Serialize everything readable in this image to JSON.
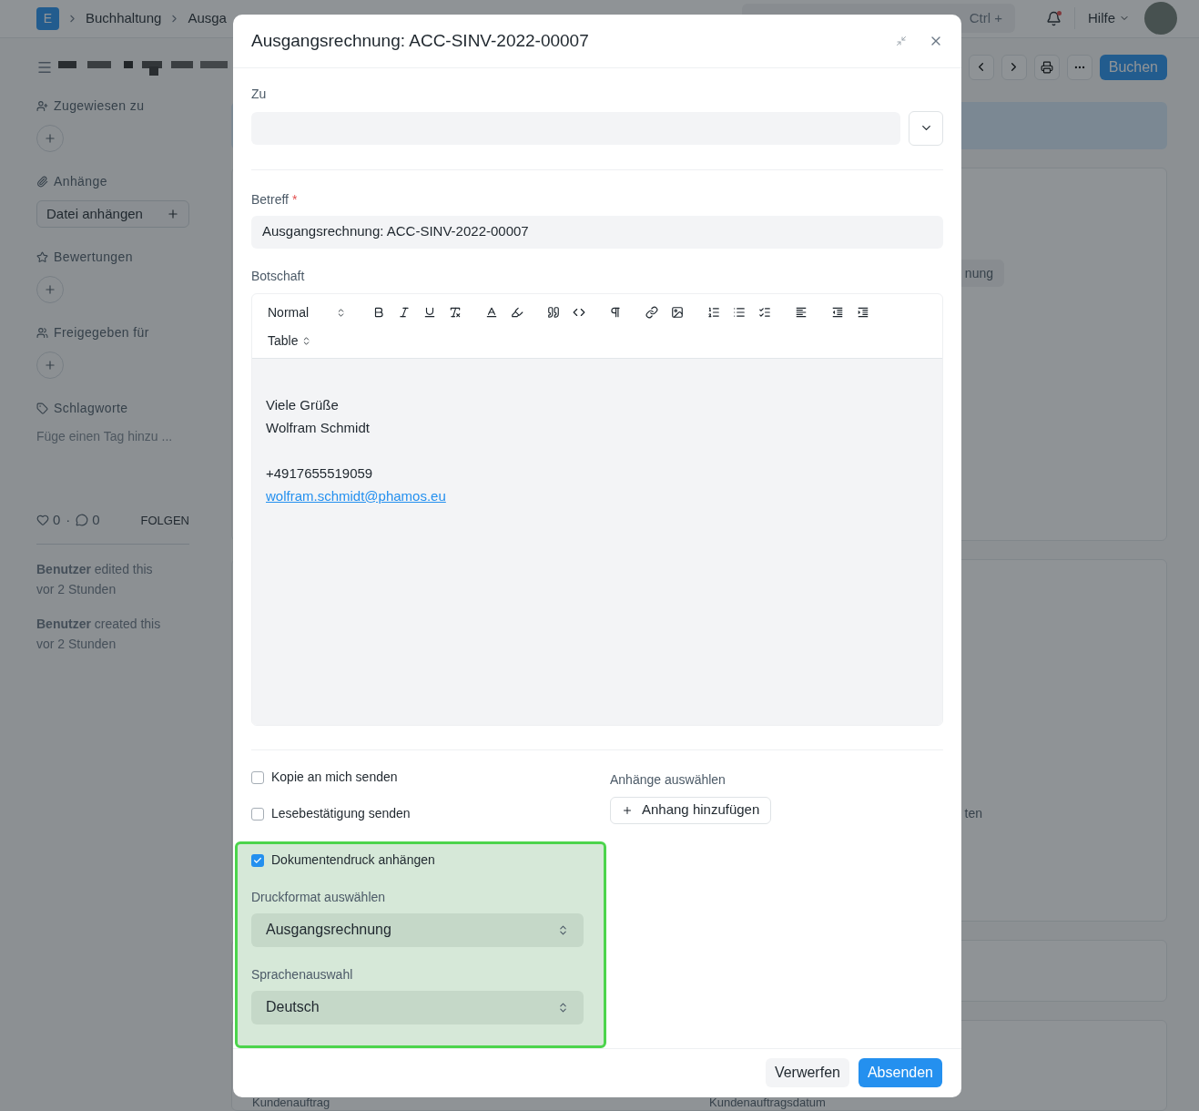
{
  "topbar": {
    "logo": "E",
    "breadcrumbs": [
      "Buchhaltung",
      "Ausga"
    ],
    "search": {
      "placeholder": "Ctrl +"
    },
    "notifications_unread": true,
    "help": "Hilfe"
  },
  "page_actions": {
    "primary": "Buchen"
  },
  "sidebar": {
    "sections": [
      {
        "kind": "add",
        "label": "Zugewiesen zu"
      },
      {
        "kind": "attach",
        "label": "Anhänge",
        "button": "Datei anhängen"
      },
      {
        "kind": "add",
        "label": "Bewertungen"
      },
      {
        "kind": "add",
        "label": "Freigegeben für"
      },
      {
        "kind": "tags",
        "label": "Schlagworte",
        "placeholder": "Füge einen Tag hinzu ..."
      }
    ],
    "likes": "0",
    "separator": "·",
    "comments": "0",
    "follow": "FOLGEN",
    "activity": [
      {
        "text": "**Benutzer** edited this",
        "time": "vor 2 Stunden"
      },
      {
        "text": "**Benutzer** created this",
        "time": "vor 2 Stunden"
      }
    ]
  },
  "background": {
    "chip": "nung",
    "fragment": "ten",
    "fields": [
      "Kundenauftrag",
      "Kundenauftragsdatum"
    ]
  },
  "dialog": {
    "title": "Ausgangsrechnung: ACC-SINV-2022-00007",
    "to": {
      "label": "Zu"
    },
    "subject": {
      "label": "Betreff",
      "required_mark": "*",
      "value": "Ausgangsrechnung: ACC-SINV-2022-00007"
    },
    "message": {
      "label": "Botschaft",
      "style_select": "Normal",
      "table_select": "Table",
      "lines": [
        "Viele Grüße",
        "Wolfram Schmidt"
      ],
      "phone": "+4917655519059",
      "email": "wolfram.schmidt@phamos.eu"
    },
    "options": [
      {
        "label": "Kopie an mich senden",
        "checked": false
      },
      {
        "label": "Lesebestätigung senden",
        "checked": false
      },
      {
        "label": "Dokumentendruck anhängen",
        "checked": true
      }
    ],
    "print_format": {
      "label": "Druckformat auswählen",
      "value": "Ausgangsrechnung"
    },
    "language": {
      "label": "Sprachenauswahl",
      "value": "Deutsch"
    },
    "attachments": {
      "label": "Anhänge auswählen",
      "button": "Anhang hinzufügen"
    },
    "buttons": [
      {
        "label": "Verwerfen",
        "kind": "secondary"
      },
      {
        "label": "Absenden",
        "kind": "primary"
      }
    ]
  }
}
